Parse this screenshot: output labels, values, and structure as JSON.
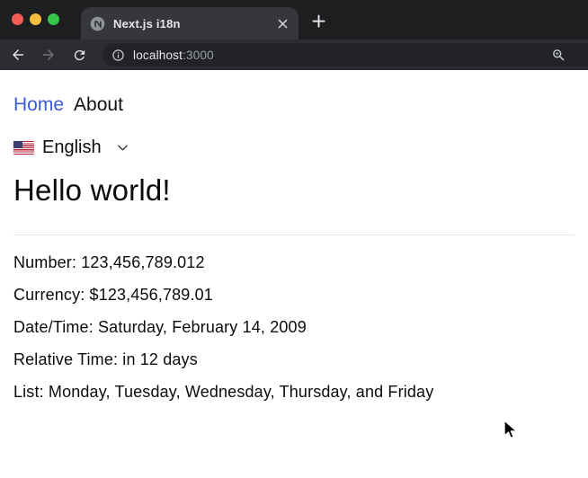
{
  "window": {
    "tab": {
      "title": "Next.js i18n"
    },
    "address": {
      "host": "localhost",
      "port": ":3000"
    }
  },
  "nav": {
    "items": [
      {
        "label": "Home"
      },
      {
        "label": "About"
      }
    ]
  },
  "language_switcher": {
    "selected_label": "English",
    "flag": "us-flag"
  },
  "main": {
    "heading": "Hello world!",
    "rows": [
      {
        "label": "Number:",
        "value": "123,456,789.012"
      },
      {
        "label": "Currency:",
        "value": "$123,456,789.01"
      },
      {
        "label": "Date/Time:",
        "value": "Saturday, February 14, 2009"
      },
      {
        "label": "Relative Time:",
        "value": "in 12 days"
      },
      {
        "label": "List:",
        "value": "Monday, Tuesday, Wednesday, Thursday, and Friday"
      }
    ]
  },
  "colors": {
    "link_accent": "#3b5bdb",
    "frame": "#1d1e20",
    "tab": "#35373a",
    "toolbar": "#2b2d30",
    "omnibox": "#212326",
    "traffic_close": "#f25c54",
    "traffic_minimize": "#f5bd3e",
    "traffic_zoom": "#35c649"
  }
}
